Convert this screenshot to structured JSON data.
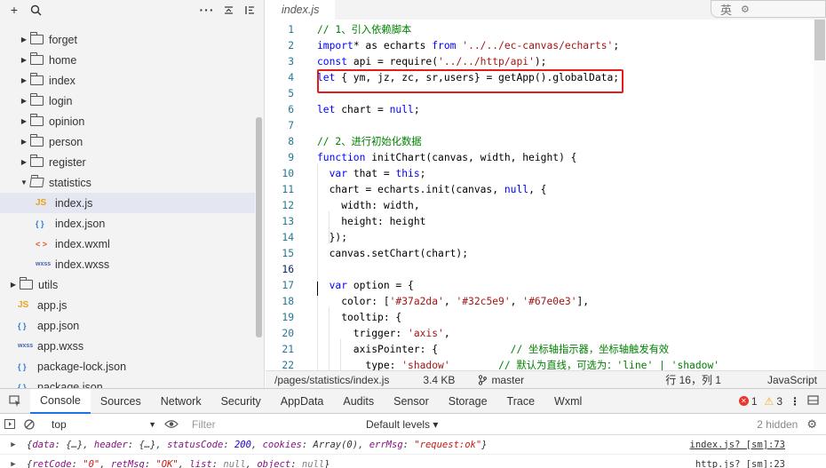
{
  "sidebar": {
    "toolbar": {
      "add": "+",
      "search": "search-icon",
      "more": "···",
      "collapse": "collapse-icon",
      "split": "split-icon"
    },
    "items": [
      {
        "label": "forget",
        "kind": "folder",
        "depth": 1
      },
      {
        "label": "home",
        "kind": "folder",
        "depth": 1
      },
      {
        "label": "index",
        "kind": "folder",
        "depth": 1
      },
      {
        "label": "login",
        "kind": "folder",
        "depth": 1
      },
      {
        "label": "opinion",
        "kind": "folder",
        "depth": 1
      },
      {
        "label": "person",
        "kind": "folder",
        "depth": 1
      },
      {
        "label": "register",
        "kind": "folder",
        "depth": 1
      },
      {
        "label": "statistics",
        "kind": "folder-open",
        "depth": 1
      },
      {
        "label": "index.js",
        "kind": "js",
        "depth": 2,
        "selected": true
      },
      {
        "label": "index.json",
        "kind": "json",
        "depth": 2
      },
      {
        "label": "index.wxml",
        "kind": "wxml",
        "depth": 2
      },
      {
        "label": "index.wxss",
        "kind": "wxss",
        "depth": 2
      },
      {
        "label": "utils",
        "kind": "folder",
        "depth": 0
      },
      {
        "label": "app.js",
        "kind": "js",
        "depth": 1
      },
      {
        "label": "app.json",
        "kind": "json",
        "depth": 1
      },
      {
        "label": "app.wxss",
        "kind": "wxss",
        "depth": 1
      },
      {
        "label": "package-lock.json",
        "kind": "json",
        "depth": 1
      },
      {
        "label": "package.json",
        "kind": "json",
        "depth": 1
      }
    ],
    "icon_glyphs": {
      "js": "JS",
      "json": "{ }",
      "wxml": "< >",
      "wxss": "wxss"
    }
  },
  "editor": {
    "tab_label": "index.js",
    "ime_label": "英",
    "current_line": 16,
    "lines": [
      {
        "n": "1",
        "tokens": [
          [
            "c-com",
            "// 1、引入依赖脚本"
          ]
        ]
      },
      {
        "n": "2",
        "tokens": [
          [
            "c-kw",
            "import"
          ],
          [
            "",
            "* as echarts "
          ],
          [
            "c-kw",
            "from"
          ],
          [
            "",
            " "
          ],
          [
            "c-str",
            "'../../ec-canvas/echarts'"
          ],
          [
            "",
            ";"
          ]
        ]
      },
      {
        "n": "3",
        "tokens": [
          [
            "c-kw",
            "const"
          ],
          [
            "",
            " api = require("
          ],
          [
            "c-str",
            "'../../http/api'"
          ],
          [
            "",
            ");"
          ]
        ]
      },
      {
        "n": "4",
        "tokens": [
          [
            "c-kw",
            "let"
          ],
          [
            "",
            " { ym, jz, zc, sr,users} = getApp().globalData;"
          ]
        ]
      },
      {
        "n": "5",
        "tokens": []
      },
      {
        "n": "6",
        "tokens": [
          [
            "c-kw",
            "let"
          ],
          [
            "",
            " chart = "
          ],
          [
            "c-kw",
            "null"
          ],
          [
            "",
            ";"
          ]
        ]
      },
      {
        "n": "7",
        "tokens": []
      },
      {
        "n": "8",
        "tokens": [
          [
            "c-com",
            "// 2、进行初始化数据"
          ]
        ]
      },
      {
        "n": "9",
        "tokens": [
          [
            "c-kw",
            "function"
          ],
          [
            "",
            " initChart(canvas, width, height) {"
          ]
        ]
      },
      {
        "n": "10",
        "tokens": [
          [
            "",
            "  "
          ],
          [
            "c-kw",
            "var"
          ],
          [
            "",
            " that = "
          ],
          [
            "c-kw",
            "this"
          ],
          [
            "",
            ";"
          ]
        ]
      },
      {
        "n": "11",
        "tokens": [
          [
            "",
            "  chart = echarts.init(canvas, "
          ],
          [
            "c-kw",
            "null"
          ],
          [
            "",
            ", {"
          ]
        ]
      },
      {
        "n": "12",
        "tokens": [
          [
            "",
            "    width: width,"
          ]
        ]
      },
      {
        "n": "13",
        "tokens": [
          [
            "",
            "    height: height"
          ]
        ]
      },
      {
        "n": "14",
        "tokens": [
          [
            "",
            "  });"
          ]
        ]
      },
      {
        "n": "15",
        "tokens": [
          [
            "",
            "  canvas.setChart(chart);"
          ]
        ]
      },
      {
        "n": "16",
        "tokens": []
      },
      {
        "n": "17",
        "tokens": [
          [
            "",
            "  "
          ],
          [
            "c-kw",
            "var"
          ],
          [
            "",
            " option = {"
          ]
        ]
      },
      {
        "n": "18",
        "tokens": [
          [
            "",
            "    color: ["
          ],
          [
            "c-str",
            "'#37a2da'"
          ],
          [
            "",
            ", "
          ],
          [
            "c-str",
            "'#32c5e9'"
          ],
          [
            "",
            ", "
          ],
          [
            "c-str",
            "'#67e0e3'"
          ],
          [
            "",
            "],"
          ]
        ]
      },
      {
        "n": "19",
        "tokens": [
          [
            "",
            "    tooltip: {"
          ]
        ]
      },
      {
        "n": "20",
        "tokens": [
          [
            "",
            "      trigger: "
          ],
          [
            "c-str",
            "'axis'"
          ],
          [
            "",
            ","
          ]
        ]
      },
      {
        "n": "21",
        "tokens": [
          [
            "",
            "      axisPointer: {            "
          ],
          [
            "c-com",
            "// 坐标轴指示器，坐标轴触发有效"
          ]
        ]
      },
      {
        "n": "22",
        "tokens": [
          [
            "",
            "        type: "
          ],
          [
            "c-str",
            "'shadow'"
          ],
          [
            "",
            "        "
          ],
          [
            "c-com",
            "// 默认为直线，可选为：'line' | 'shadow'"
          ]
        ]
      }
    ]
  },
  "status": {
    "path": "/pages/statistics/index.js",
    "size": "3.4 KB",
    "branch": "master",
    "position": "行 16，列 1",
    "language": "JavaScript"
  },
  "devtools": {
    "tabs": [
      "Console",
      "Sources",
      "Network",
      "Security",
      "AppData",
      "Audits",
      "Sensor",
      "Storage",
      "Trace",
      "Wxml"
    ],
    "active_tab": "Console",
    "errors": "1",
    "warnings": "3",
    "context": "top",
    "filter_placeholder": "Filter",
    "levels": "Default levels ▾",
    "hidden": "2 hidden",
    "logs": [
      {
        "src": "index.js? [sm]:73"
      },
      {
        "src": "http.js? [sm]:23"
      }
    ]
  }
}
